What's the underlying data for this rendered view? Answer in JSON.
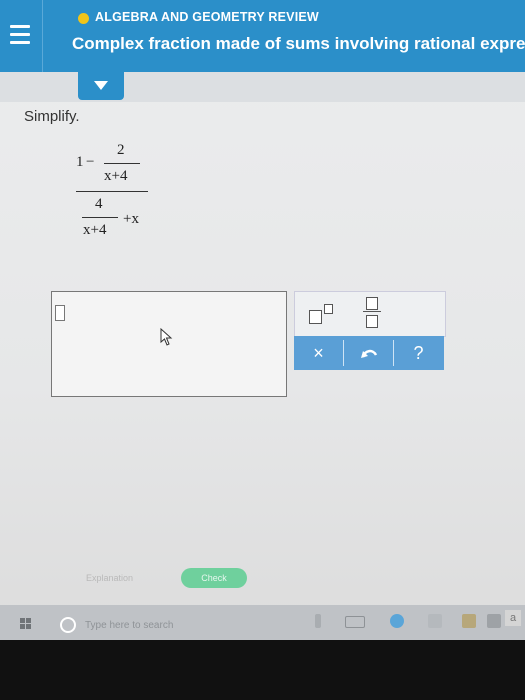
{
  "header": {
    "topic": "ALGEBRA AND GEOMETRY REVIEW",
    "title": "Complex fraction made of sums involving rational expression",
    "topic_dot_color": "#f0c419",
    "bar_color": "#2b8fc9"
  },
  "problem": {
    "instruction": "Simplify.",
    "num_one": "1",
    "num_minus": "−",
    "num_frac_top": "2",
    "num_frac_bottom": "x+4",
    "den_frac_top": "4",
    "den_frac_bottom": "x+4",
    "den_plus_x": "+x"
  },
  "toolbar": {
    "exponent_icon": "exponent-icon",
    "fraction_icon": "fraction-icon",
    "clear_label": "×",
    "undo_icon": "undo-icon",
    "help_label": "?"
  },
  "footer": {
    "explanation_label": "Explanation",
    "check_label": "Check"
  },
  "taskbar": {
    "search_placeholder": "Type here to search",
    "corner_letter": "a"
  }
}
